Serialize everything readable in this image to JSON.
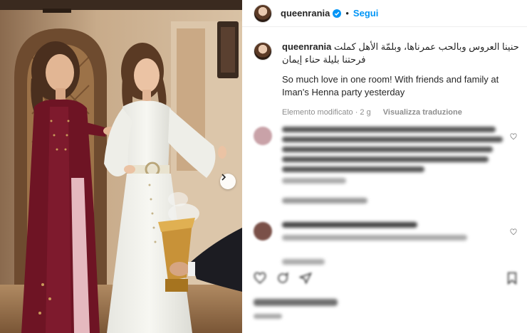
{
  "post": {
    "username": "queenrania",
    "follow_label": "Segui",
    "separator": "•",
    "caption_arabic": "حنينا العروس وبالحب عمرناها، وبلمّة الأهل كملت فرحتنا بليلة حناء إيمان",
    "caption_english": "So much love in one room! With friends and family at Iman's Henna party yesterday",
    "meta_text": "Elemento modificato · 2 g",
    "translate_label": "Visualizza traduzione"
  },
  "icons": {
    "verified": "verified-badge-icon",
    "next": "chevron-right-icon",
    "like": "heart-icon",
    "comment": "comment-icon",
    "share": "send-icon",
    "save": "bookmark-icon"
  },
  "colors": {
    "accent": "#0095f6",
    "text": "#262626",
    "muted": "#8e8e8e"
  }
}
